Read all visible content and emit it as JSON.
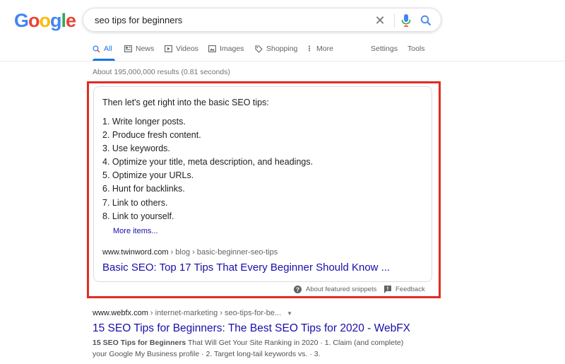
{
  "logo": {
    "letters": [
      "G",
      "o",
      "o",
      "g",
      "l",
      "e"
    ],
    "colors": [
      "#4285f4",
      "#ea4335",
      "#fbbc05",
      "#4285f4",
      "#34a853",
      "#ea4335"
    ]
  },
  "search": {
    "query": "seo tips for beginners",
    "clear_icon": "close-icon",
    "mic_icon": "microphone-icon",
    "search_icon": "search-icon"
  },
  "tabs": {
    "all": "All",
    "news": "News",
    "videos": "Videos",
    "images": "Images",
    "shopping": "Shopping",
    "more": "More",
    "settings": "Settings",
    "tools": "Tools"
  },
  "result_stats": "About 195,000,000 results (0.81 seconds)",
  "featured_snippet": {
    "heading": "Then let's get right into the basic SEO tips:",
    "items": [
      "1. Write longer posts.",
      "2. Produce fresh content.",
      "3. Use keywords.",
      "4. Optimize your title, meta description, and headings.",
      "5. Optimize your URLs.",
      "6. Hunt for backlinks.",
      "7. Link to others.",
      "8. Link to yourself."
    ],
    "more_items": "More items...",
    "cite_domain": "www.twinword.com",
    "cite_path": " › blog › basic-beginner-seo-tips",
    "title": "Basic SEO: Top 17 Tips That Every Beginner Should Know ...",
    "about_label": "About featured snippets",
    "feedback_label": "Feedback",
    "highlight_color": "#e32b22"
  },
  "result": {
    "cite_domain": "www.webfx.com",
    "cite_path": " › internet-marketing › seo-tips-for-be...",
    "title": "15 SEO Tips for Beginners: The Best SEO Tips for 2020 - WebFX",
    "desc_bold": "15 SEO Tips for Beginners",
    "desc_rest": " That Will Get Your Site Ranking in 2020 · 1. Claim (and complete) your Google My Business profile · 2. Target long-tail keywords vs. · 3."
  }
}
